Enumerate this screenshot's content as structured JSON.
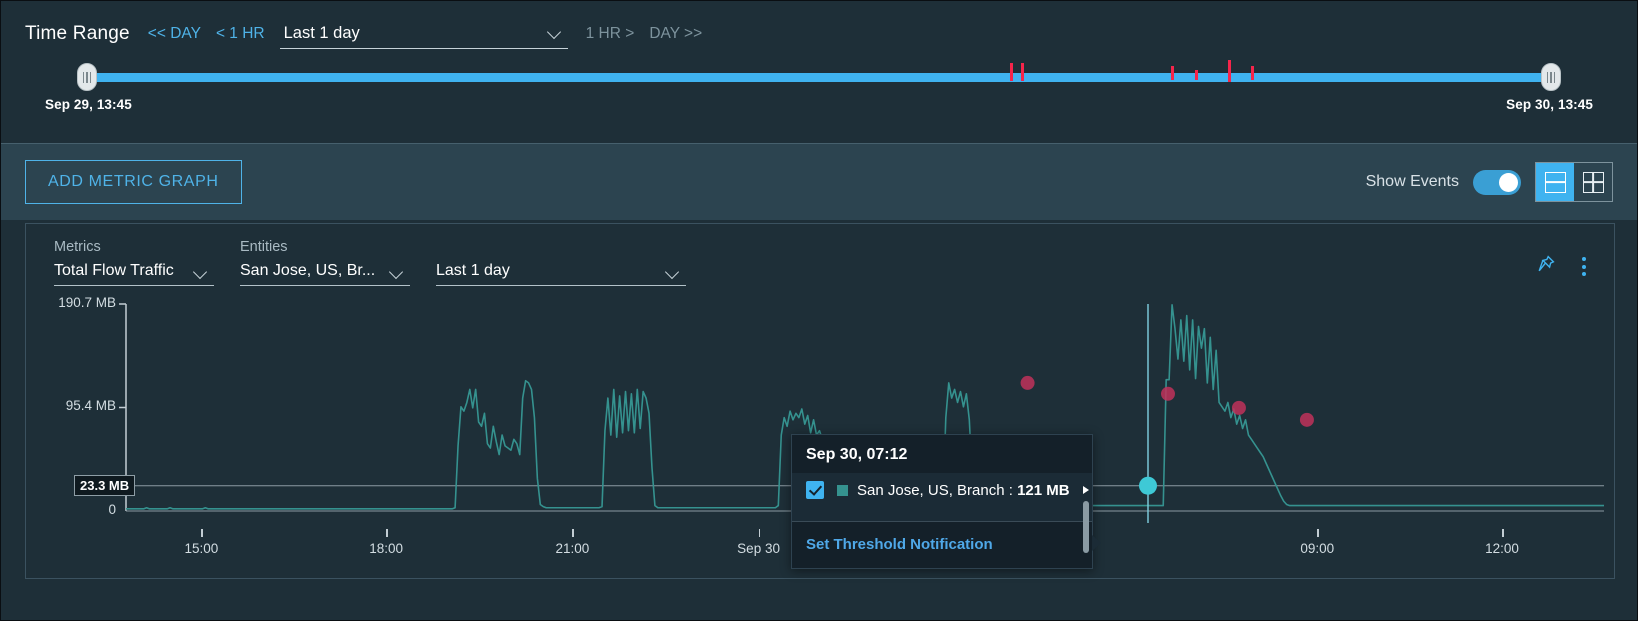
{
  "time_range": {
    "title": "Time Range",
    "nav_prev_day": "<< DAY",
    "nav_prev_hr": "< 1 HR",
    "selected": "Last 1 day",
    "nav_next_hr": "1 HR >",
    "nav_next_day": "DAY >>",
    "start_label": "Sep 29, 13:45",
    "end_label": "Sep 30, 13:45",
    "event_marks": [
      {
        "left_pct": 61.9,
        "height": 18,
        "top": -4
      },
      {
        "left_pct": 62.7,
        "height": 18,
        "top": -4
      },
      {
        "left_pct": 72.8,
        "height": 14,
        "top": -1
      },
      {
        "left_pct": 74.4,
        "height": 10,
        "top": 3
      },
      {
        "left_pct": 76.6,
        "height": 22,
        "top": -7
      },
      {
        "left_pct": 78.2,
        "height": 14,
        "top": -1
      }
    ]
  },
  "toolbar": {
    "add_button": "ADD METRIC GRAPH",
    "show_events_label": "Show Events",
    "show_events_on": true,
    "view_single": "single-row-view",
    "view_grid": "grid-view"
  },
  "card": {
    "metrics_label": "Metrics",
    "metrics_value": "Total Flow Traffic",
    "entities_label": "Entities",
    "entities_value": "San Jose, US, Br...",
    "time_value": "Last 1 day",
    "pin_icon": "pin-icon",
    "menu_icon": "more-vertical-icon"
  },
  "tooltip": {
    "timestamp": "Sep 30, 07:12",
    "series_label": "San Jose, US, Branch",
    "separator": ":",
    "value": "121 MB",
    "checked": true,
    "link": "Set Threshold Notification"
  },
  "chart_data": {
    "type": "line",
    "title": "Total Flow Traffic",
    "xlabel": "",
    "ylabel": "",
    "series": [
      {
        "name": "San Jose, US, Branch",
        "color": "#35928f",
        "unit": "MB"
      }
    ],
    "ylim": [
      0,
      190.7
    ],
    "yticks": [
      {
        "value": 190.7,
        "label": "190.7 MB"
      },
      {
        "value": 95.4,
        "label": "95.4 MB"
      },
      {
        "value": 0,
        "label": "0"
      }
    ],
    "threshold": {
      "value": 23.3,
      "label": "23.3 MB"
    },
    "xticks": [
      {
        "label": "15:00",
        "pos_pct": 5.1
      },
      {
        "label": "18:00",
        "pos_pct": 17.6
      },
      {
        "label": "21:00",
        "pos_pct": 30.2
      },
      {
        "label": "Sep 30",
        "pos_pct": 42.8
      },
      {
        "label": "09:00",
        "pos_pct": 80.6
      },
      {
        "label": "12:00",
        "pos_pct": 93.1
      }
    ],
    "grid": false,
    "legend": "none",
    "highlight_point": {
      "time": "Sep 30, 07:12",
      "value": 121,
      "unit": "MB"
    },
    "event_points": [
      {
        "x_pct": 61.0,
        "y_value": 118
      },
      {
        "x_pct": 70.5,
        "y_value": 108
      },
      {
        "x_pct": 75.3,
        "y_value": 95
      },
      {
        "x_pct": 79.9,
        "y_value": 84
      }
    ],
    "values": [
      2,
      2,
      2,
      2,
      2,
      2,
      2,
      3,
      2,
      2,
      2,
      2,
      2,
      2,
      2,
      3,
      2,
      2,
      2,
      2,
      2,
      2,
      2,
      2,
      2,
      2,
      2,
      3,
      2,
      2,
      2,
      2,
      2,
      2,
      2,
      2,
      2,
      2,
      2,
      2,
      2,
      2,
      2,
      2,
      2,
      2,
      2,
      2,
      2,
      2,
      2,
      2,
      2,
      2,
      2,
      2,
      2,
      2,
      2,
      2,
      2,
      2,
      2,
      2,
      2,
      2,
      2,
      2,
      2,
      2,
      2,
      2,
      2,
      2,
      2,
      2,
      2,
      2,
      2,
      2,
      2,
      2,
      2,
      2,
      2,
      2,
      2,
      2,
      2,
      2,
      2,
      2,
      2,
      2,
      2,
      2,
      2,
      2,
      2,
      2,
      2,
      2,
      2,
      2,
      2,
      2,
      2,
      2,
      2,
      2,
      2,
      2,
      3,
      60,
      96,
      92,
      100,
      112,
      95,
      112,
      82,
      78,
      90,
      62,
      58,
      78,
      64,
      52,
      70,
      60,
      58,
      56,
      66,
      62,
      52,
      104,
      120,
      118,
      112,
      86,
      30,
      6,
      4,
      3,
      3,
      3,
      3,
      3,
      3,
      3,
      3,
      3,
      3,
      3,
      3,
      3,
      3,
      3,
      3,
      3,
      3,
      3,
      4,
      74,
      104,
      70,
      112,
      68,
      106,
      72,
      110,
      74,
      108,
      72,
      112,
      76,
      110,
      104,
      90,
      40,
      5,
      3,
      3,
      3,
      3,
      3,
      3,
      3,
      3,
      3,
      3,
      3,
      3,
      3,
      3,
      3,
      3,
      3,
      3,
      3,
      3,
      3,
      3,
      3,
      3,
      3,
      3,
      3,
      3,
      3,
      3,
      3,
      3,
      3,
      3,
      3,
      3,
      3,
      3,
      3,
      3,
      3,
      5,
      70,
      86,
      78,
      92,
      84,
      90,
      86,
      94,
      80,
      88,
      72,
      84,
      70,
      74,
      66,
      62,
      58,
      52,
      48,
      42,
      36,
      30,
      26,
      22,
      18,
      14,
      10,
      8,
      6,
      5,
      4,
      4,
      4,
      4,
      4,
      4,
      4,
      4,
      4,
      4,
      4,
      4,
      4,
      4,
      4,
      4,
      4,
      4,
      4,
      4,
      4,
      4,
      4,
      4,
      4,
      6,
      86,
      118,
      104,
      112,
      100,
      110,
      96,
      108,
      84,
      30,
      8,
      5,
      5,
      5,
      5,
      5,
      5,
      5,
      5,
      5,
      5,
      5,
      5,
      45,
      40,
      22,
      10,
      6,
      5,
      5,
      5,
      5,
      5,
      5,
      5,
      5,
      5,
      5,
      5,
      5,
      5,
      5,
      5,
      5,
      5,
      5,
      5,
      5,
      5,
      5,
      5,
      5,
      5,
      5,
      5,
      5,
      5,
      5,
      5,
      5,
      5,
      5,
      5,
      5,
      5,
      5,
      5,
      5,
      5,
      5,
      5,
      5,
      5,
      5,
      5,
      121,
      121,
      190,
      168,
      140,
      176,
      138,
      180,
      130,
      176,
      122,
      170,
      150,
      168,
      118,
      160,
      112,
      148,
      100,
      96,
      92,
      100,
      86,
      94,
      80,
      88,
      76,
      84,
      70,
      66,
      62,
      58,
      54,
      50,
      44,
      38,
      32,
      26,
      20,
      14,
      9,
      6,
      5,
      5,
      5,
      5,
      5,
      5,
      5,
      5,
      5,
      5,
      5,
      5,
      5,
      5,
      5,
      5,
      5,
      5,
      5,
      5,
      5,
      5,
      5,
      5,
      5,
      5,
      5,
      5,
      5,
      5,
      5,
      5,
      5,
      5,
      5,
      5,
      5,
      5,
      5,
      5,
      5,
      5,
      5,
      5,
      5,
      5,
      5,
      5,
      5,
      5,
      5,
      5,
      5,
      5,
      5,
      5,
      5,
      5,
      5,
      5,
      5,
      5,
      5,
      5,
      5,
      5,
      5,
      5,
      5,
      5,
      5,
      5,
      5,
      5,
      5,
      5,
      5,
      5,
      5,
      5,
      5,
      5,
      5,
      5,
      5,
      5,
      5,
      5,
      5,
      5,
      5,
      5,
      5,
      5,
      5,
      5,
      5,
      5,
      5,
      5,
      5,
      5,
      5,
      5,
      5,
      5,
      5,
      5
    ]
  }
}
